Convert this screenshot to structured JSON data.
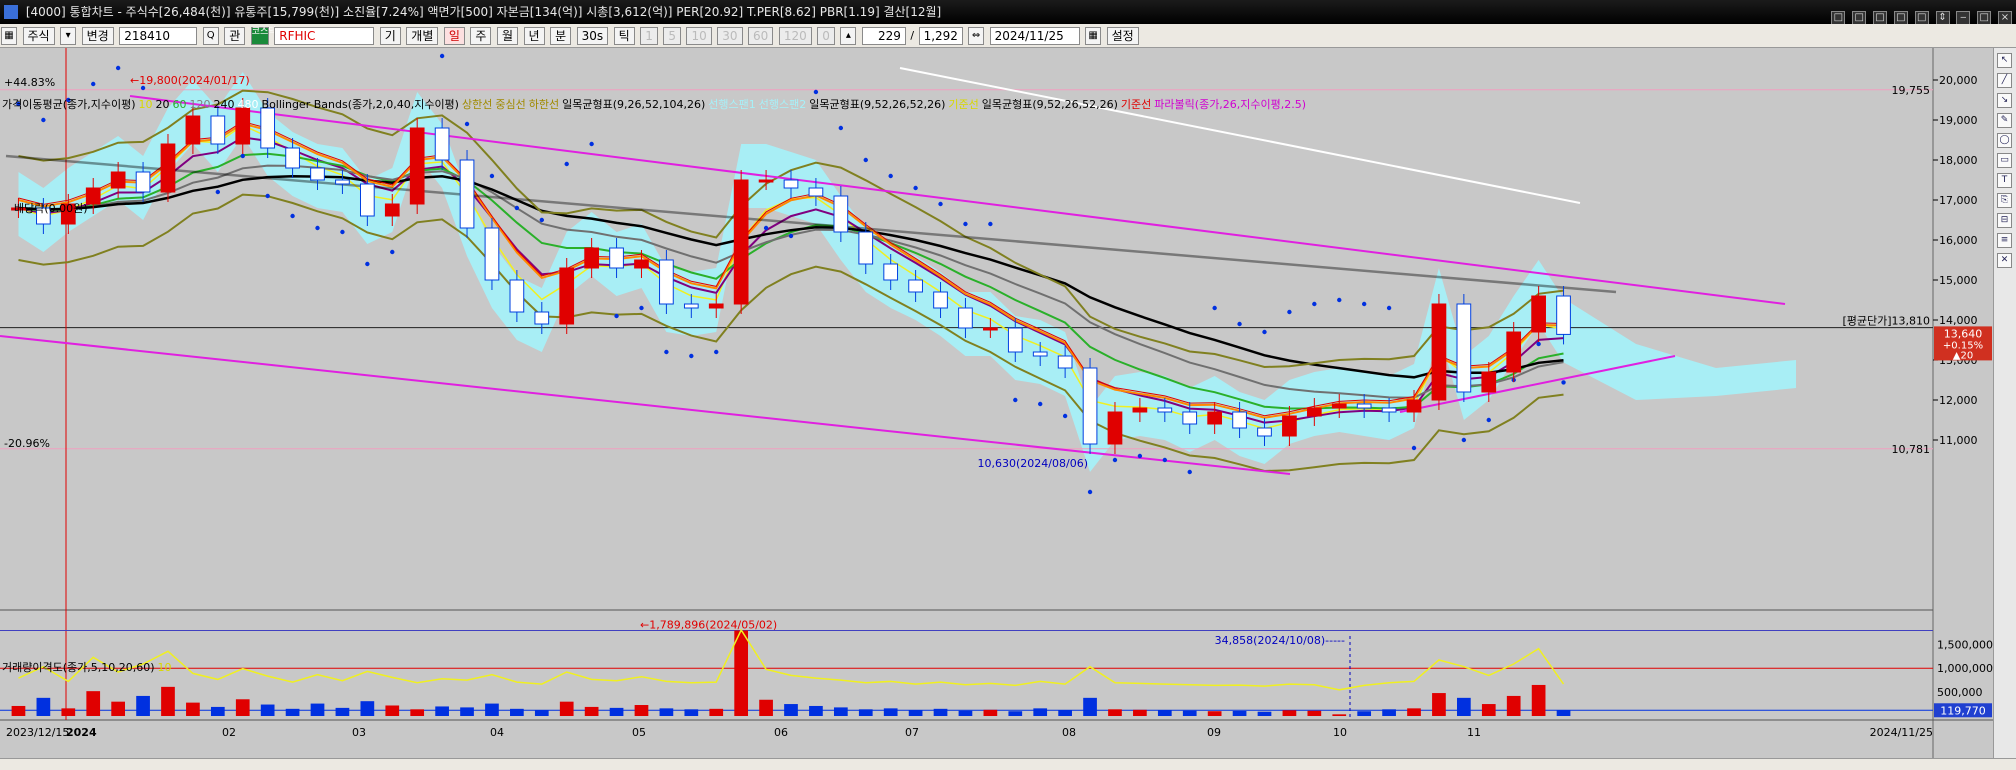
{
  "title_bar": {
    "text": "[4000] 통합차트 - 주식수[26,484(천)] 유통주[15,799(천)] 소진율[7.24%] 액면가[500] 자본금[134(억)] 시총[3,612(억)] PER[20.92] T.PER[8.62] PBR[1.19] 결산[12월]",
    "window_buttons": [
      "□",
      "□",
      "□",
      "□",
      "□",
      "⇕",
      "‒",
      "□",
      "×"
    ]
  },
  "toolbar": {
    "market": "주식",
    "change": "변경",
    "code": "218410",
    "magnifier": "Q",
    "link": "관",
    "badge": "코스닥",
    "name": "RFHIC",
    "period_buttons": [
      "기",
      "개별",
      "일",
      "주",
      "월",
      "년",
      "분",
      "30s",
      "틱"
    ],
    "interval_buttons": [
      "1",
      "5",
      "10",
      "30",
      "60",
      "120",
      "0"
    ],
    "count": "229",
    "divider": "/",
    "total": "1,292",
    "date": "2024/11/25",
    "settings": "설정"
  },
  "legend_price": [
    {
      "text": "가격이동평균(종가,지수이평)",
      "color": "#000000"
    },
    {
      "text": "10",
      "color": "#d8d800"
    },
    {
      "text": "20",
      "color": "#000000"
    },
    {
      "text": "60",
      "color": "#2ab02a"
    },
    {
      "text": "120",
      "color": "#808080"
    },
    {
      "text": "240",
      "color": "#000000"
    },
    {
      "text": "480",
      "color": "#ffffff"
    },
    {
      "text": "Bollinger Bands(종가,2,0,40,지수이평)",
      "color": "#000000"
    },
    {
      "text": "상한선",
      "color": "#a08a00"
    },
    {
      "text": "중심선",
      "color": "#a08a00"
    },
    {
      "text": "하한선",
      "color": "#a08a00"
    },
    {
      "text": "일목균형표(9,26,52,104,26)",
      "color": "#000000"
    },
    {
      "text": "선행스팬1",
      "color": "#a6f0f8"
    },
    {
      "text": "선행스팬2",
      "color": "#a6f0f8"
    },
    {
      "text": "일목균형표(9,52,26,52,26)",
      "color": "#000000"
    },
    {
      "text": "기준선",
      "color": "#d8d800"
    },
    {
      "text": "일목균형표(9,52,26,52,26)",
      "color": "#000000"
    },
    {
      "text": "기준선",
      "color": "#e00000"
    },
    {
      "text": "파라볼릭(종가,26,지수이평,2.5)",
      "color": "#d000d0"
    }
  ],
  "legend_volume": [
    {
      "text": "거래량이격도(종가,5,10,20,60)",
      "color": "#000000"
    },
    {
      "text": "10",
      "color": "#d8d800"
    }
  ],
  "chart_data": {
    "type": "candlestick",
    "price_axis": {
      "min": 10300,
      "max": 20300,
      "ticks": [
        20000,
        19000,
        18000,
        17000,
        16000,
        15000,
        14000,
        13000,
        12000,
        11000
      ]
    },
    "x_axis": {
      "start": "2023/12/15",
      "end": "2024/11/25",
      "labels": [
        "2023/12/15",
        "2024",
        "02",
        "03",
        "04",
        "05",
        "06",
        "07",
        "08",
        "09",
        "10",
        "11",
        "2024/11/25"
      ]
    },
    "annotations": {
      "high": "19,800(2024/01/17)",
      "low": "10,630(2024/08/06)",
      "max_pct": "+44.83%",
      "min_pct": "-20.96%",
      "high_line": "19,755",
      "low_line": "10,781",
      "avg_cost": "[평균단가]13,810",
      "dividend": "배당락(0.00원)",
      "vol_peak": "1,789,896(2024/05/02)",
      "vol_mark": "34,858(2024/10/08)"
    },
    "current": {
      "price": "13,640",
      "change_pct": "+0.15%",
      "change": "▲20"
    },
    "closes": [
      16800,
      16400,
      16900,
      17300,
      17700,
      17200,
      18400,
      19100,
      18400,
      19300,
      18300,
      17800,
      17500,
      17400,
      16600,
      16900,
      18800,
      18000,
      16300,
      15000,
      14200,
      13900,
      15300,
      15800,
      15300,
      15500,
      14400,
      14300,
      14400,
      17500,
      17500,
      17300,
      17100,
      16200,
      15400,
      15000,
      14700,
      14300,
      13800,
      13800,
      13200,
      13100,
      12800,
      10900,
      11700,
      11800,
      11700,
      11400,
      11700,
      11300,
      11100,
      11600,
      11800,
      11900,
      11800,
      11700,
      12000,
      14400,
      12200,
      12700,
      13700,
      14600,
      13640
    ],
    "volume_axis": {
      "ticks": [
        "1,500,000",
        "1,000,000",
        "500,000"
      ],
      "current": "119,770"
    },
    "volumes": [
      210000,
      380000,
      160000,
      520000,
      300000,
      420000,
      610000,
      280000,
      190000,
      350000,
      240000,
      150000,
      260000,
      170000,
      310000,
      220000,
      140000,
      200000,
      180000,
      260000,
      150000,
      120000,
      300000,
      190000,
      170000,
      230000,
      160000,
      140000,
      150000,
      1789896,
      340000,
      250000,
      210000,
      180000,
      140000,
      160000,
      120000,
      150000,
      110000,
      130000,
      100000,
      160000,
      120000,
      380000,
      140000,
      130000,
      120000,
      110000,
      100000,
      105000,
      90000,
      120000,
      110000,
      34858,
      100000,
      140000,
      160000,
      480000,
      380000,
      250000,
      420000,
      650000,
      119770
    ]
  }
}
